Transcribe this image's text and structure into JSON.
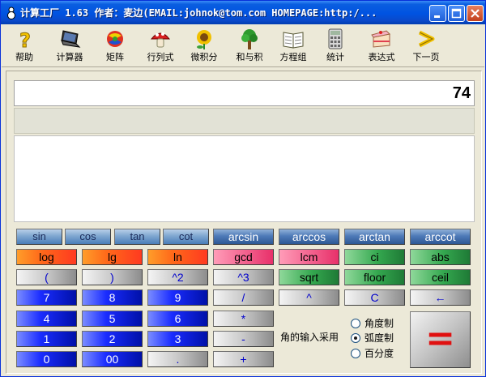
{
  "window": {
    "title": "计算工厂 1.63 作者：麦边(EMAIL:johnok@tom.com HOMEPAGE:http:/...",
    "controls": [
      "minimize",
      "maximize",
      "close"
    ]
  },
  "toolbar": {
    "items": [
      {
        "label": "帮助",
        "icon": "question-icon"
      },
      {
        "label": "计算器",
        "icon": "laptop-icon"
      },
      {
        "label": "矩阵",
        "icon": "colorful-ball-icon"
      },
      {
        "label": "行列式",
        "icon": "mushroom-icon"
      },
      {
        "label": "微积分",
        "icon": "sunflower-icon"
      },
      {
        "label": "和与积",
        "icon": "tree-icon"
      },
      {
        "label": "方程组",
        "icon": "book-icon"
      },
      {
        "label": "统计",
        "icon": "calculator-icon"
      },
      {
        "label": "表达式",
        "icon": "cake-icon"
      },
      {
        "label": "下一页",
        "icon": "next-arrow-icon"
      }
    ]
  },
  "display": {
    "result": "74",
    "expression": "",
    "work": ""
  },
  "buttons": {
    "trig": [
      "sin",
      "cos",
      "tan",
      "cot"
    ],
    "arc": [
      "arcsin",
      "arccos",
      "arctan",
      "arccot"
    ],
    "row_log": [
      "log",
      "lg",
      "ln",
      "gcd",
      "lcm",
      "ci",
      "abs"
    ],
    "row_paren": [
      "(",
      ")",
      "^2",
      "^3",
      "sqrt",
      "floor",
      "ceil"
    ],
    "row_7": [
      "7",
      "8",
      "9",
      "/",
      "^",
      "C",
      "←"
    ],
    "row_4": [
      "4",
      "5",
      "6",
      "*"
    ],
    "row_1": [
      "1",
      "2",
      "3",
      "-"
    ],
    "row_0": [
      "0",
      "00",
      ".",
      "+"
    ],
    "equals": "="
  },
  "angle": {
    "label": "角的输入采用",
    "options": [
      {
        "label": "角度制",
        "selected": false
      },
      {
        "label": "弧度制",
        "selected": true
      },
      {
        "label": "百分度",
        "selected": false
      }
    ]
  },
  "colors": {
    "title_bar": "#0053e1",
    "trig_button": "#7fa7d0",
    "arc_button": "#4e7ab8",
    "orange_button": "#ff6a1a",
    "pink_button": "#e8306a",
    "green_button": "#34a84f",
    "gray_button": "#c8c8c8",
    "number_button": "#1a2cff",
    "equals_sign": "#e01010"
  }
}
